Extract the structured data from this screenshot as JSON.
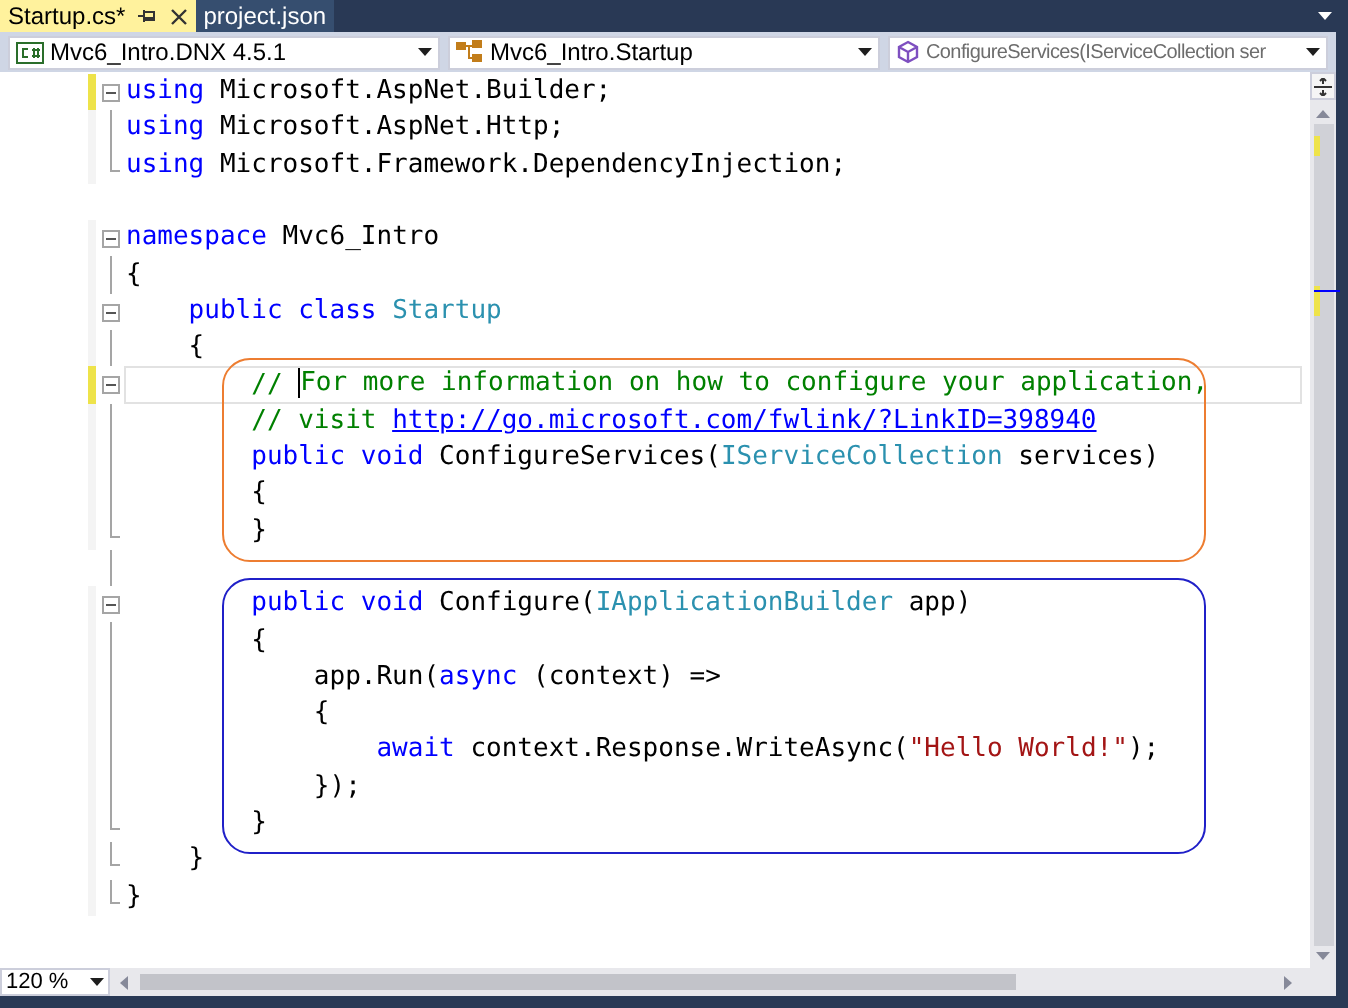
{
  "tabs": [
    {
      "label": "Startup.cs*",
      "selected": true,
      "pinned": true
    },
    {
      "label": "project.json",
      "selected": false,
      "pinned": false
    }
  ],
  "nav_bar": [
    {
      "kind": "project",
      "text": "Mvc6_Intro.DNX 4.5.1"
    },
    {
      "kind": "class",
      "text": "Mvc6_Intro.Startup"
    },
    {
      "kind": "method",
      "text": "ConfigureServices(IServiceCollection ser"
    }
  ],
  "code_blocks": [
    {
      "lines": [
        {
          "kind": "fold-start",
          "changed": true,
          "current": false,
          "tokens": [
            {
              "kind": "keyword",
              "text": "using"
            },
            {
              "kind": "plain",
              "text": " Microsoft.AspNet.Builder;"
            }
          ]
        },
        {
          "kind": "fold-inner",
          "changed": false,
          "current": false,
          "tokens": [
            {
              "kind": "keyword",
              "text": "using"
            },
            {
              "kind": "plain",
              "text": " Microsoft.AspNet.Http;"
            }
          ]
        },
        {
          "kind": "fold-end",
          "changed": false,
          "current": false,
          "tokens": [
            {
              "kind": "keyword",
              "text": "using"
            },
            {
              "kind": "plain",
              "text": " Microsoft.Framework.DependencyInjection;"
            }
          ]
        },
        {
          "kind": "blank"
        },
        {
          "kind": "fold-start",
          "changed": false,
          "current": false,
          "tokens": [
            {
              "kind": "keyword",
              "text": "namespace"
            },
            {
              "kind": "plain",
              "text": " Mvc6_Intro"
            }
          ]
        },
        {
          "kind": "fold-inner",
          "changed": false,
          "current": false,
          "tokens": [
            {
              "kind": "plain",
              "text": "{"
            }
          ]
        },
        {
          "kind": "fold-start",
          "changed": false,
          "current": false,
          "tokens": [
            {
              "kind": "keyword",
              "text": "    public class "
            },
            {
              "kind": "type",
              "text": "Startup"
            }
          ]
        },
        {
          "kind": "fold-inner",
          "changed": false,
          "current": false,
          "tokens": [
            {
              "kind": "plain",
              "text": "    {"
            }
          ]
        }
      ]
    },
    {
      "color": "#ed7d31",
      "lines": [
        {
          "kind": "fold-start",
          "changed": true,
          "current": true,
          "tokens": [
            {
              "kind": "comment",
              "text": "        // "
            },
            {
              "kind": "comment",
              "text": "For more information on how to configure your application,",
              "cursor": true
            }
          ]
        },
        {
          "kind": "fold-inner",
          "changed": false,
          "current": false,
          "tokens": [
            {
              "kind": "comment",
              "text": "        // visit "
            },
            {
              "kind": "link",
              "text": "http://go.microsoft.com/fwlink/?LinkID=398940"
            }
          ]
        },
        {
          "kind": "fold-inner",
          "changed": false,
          "current": false,
          "tokens": [
            {
              "kind": "keyword",
              "text": "        public void"
            },
            {
              "kind": "plain",
              "text": " ConfigureServices("
            },
            {
              "kind": "type",
              "text": "IServiceCollection"
            },
            {
              "kind": "plain",
              "text": " services)"
            }
          ]
        },
        {
          "kind": "fold-inner",
          "changed": false,
          "current": false,
          "tokens": [
            {
              "kind": "plain",
              "text": "        {"
            }
          ]
        },
        {
          "kind": "fold-end",
          "changed": false,
          "current": false,
          "tokens": [
            {
              "kind": "plain",
              "text": "        }"
            }
          ]
        }
      ]
    },
    {
      "lines": [
        {
          "kind": "guide"
        }
      ]
    },
    {
      "color": "#2020c8",
      "lines": [
        {
          "kind": "fold-start",
          "changed": false,
          "current": false,
          "tokens": [
            {
              "kind": "keyword",
              "text": "        public void"
            },
            {
              "kind": "plain",
              "text": " Configure("
            },
            {
              "kind": "type",
              "text": "IApplicationBuilder"
            },
            {
              "kind": "plain",
              "text": " app)"
            }
          ]
        },
        {
          "kind": "fold-inner",
          "changed": false,
          "current": false,
          "tokens": [
            {
              "kind": "plain",
              "text": "        {"
            }
          ]
        },
        {
          "kind": "fold-inner",
          "changed": false,
          "current": false,
          "tokens": [
            {
              "kind": "plain",
              "text": "            app.Run("
            },
            {
              "kind": "keyword",
              "text": "async"
            },
            {
              "kind": "plain",
              "text": " (context) =>"
            }
          ]
        },
        {
          "kind": "fold-inner",
          "changed": false,
          "current": false,
          "tokens": [
            {
              "kind": "plain",
              "text": "            {"
            }
          ]
        },
        {
          "kind": "fold-inner",
          "changed": false,
          "current": false,
          "tokens": [
            {
              "kind": "keyword",
              "text": "                await"
            },
            {
              "kind": "plain",
              "text": " context.Response.WriteAsync("
            },
            {
              "kind": "string",
              "text": "\"Hello World!\""
            },
            {
              "kind": "plain",
              "text": ");"
            }
          ]
        },
        {
          "kind": "fold-inner",
          "changed": false,
          "current": false,
          "tokens": [
            {
              "kind": "plain",
              "text": "            });"
            }
          ]
        },
        {
          "kind": "fold-end",
          "changed": false,
          "current": false,
          "tokens": [
            {
              "kind": "plain",
              "text": "        }"
            }
          ]
        }
      ]
    },
    {
      "lines": [
        {
          "kind": "fold-end",
          "changed": false,
          "current": false,
          "tokens": [
            {
              "kind": "plain",
              "text": "    }"
            }
          ]
        },
        {
          "kind": "fold-end",
          "changed": false,
          "current": false,
          "tokens": [
            {
              "kind": "plain",
              "text": "}"
            }
          ]
        }
      ]
    }
  ],
  "zoom": "120 %"
}
